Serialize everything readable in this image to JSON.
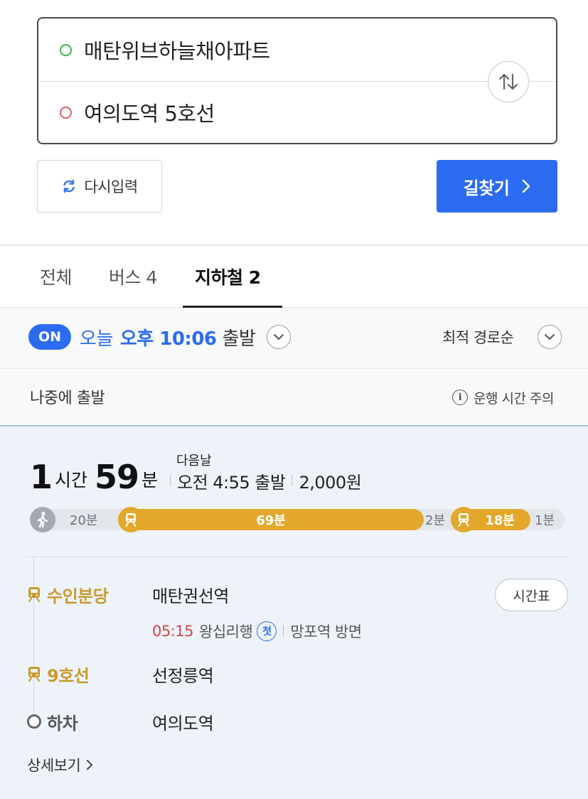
{
  "search": {
    "origin": "매탄위브하늘채아파트",
    "destination": "여의도역 5호선",
    "reset_label": "다시입력",
    "search_label": "길찾기"
  },
  "tabs": [
    {
      "label": "전체",
      "active": false
    },
    {
      "label": "버스 4",
      "active": false
    },
    {
      "label": "지하철 2",
      "active": true
    }
  ],
  "options": {
    "on_badge": "ON",
    "today": "오늘",
    "depart_time": "오후 10:06",
    "depart_suffix": "출발",
    "sort": "최적 경로순",
    "later": "나중에 출발",
    "notice": "운행 시간 주의"
  },
  "route": {
    "hours": "1",
    "hours_unit": "시간",
    "minutes": "59",
    "minutes_unit": "분",
    "next_day": "다음날",
    "depart": "오전 4:55 출발",
    "fare": "2,000원",
    "timeline": {
      "walk1": "20분",
      "ride1": "69분",
      "transfer": "2분",
      "ride2": "18분",
      "walk2": "1분"
    },
    "steps": [
      {
        "line": "수인분당",
        "station": "매탄권선역"
      },
      {
        "line": "9호선",
        "station": "선정릉역"
      },
      {
        "line": "하차",
        "station": "여의도역"
      }
    ],
    "timetable_label": "시간표",
    "first_departure": "05:15",
    "direction": "왕십리행",
    "first_badge": "첫",
    "platform": "망포역 방면",
    "detail_label": "상세보기"
  },
  "colors": {
    "accent": "#2b6cf0",
    "subway_line": "#e3a82b",
    "walk": "#a4a9b2",
    "time_red": "#d64545"
  }
}
